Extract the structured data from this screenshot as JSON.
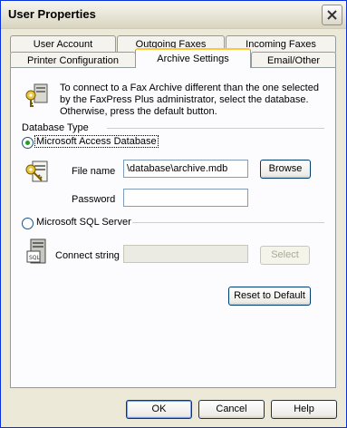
{
  "window": {
    "title": "User Properties"
  },
  "tabs_row1": [
    {
      "label": "User Account"
    },
    {
      "label": "Outgoing Faxes"
    },
    {
      "label": "Incoming Faxes"
    }
  ],
  "tabs_row2": [
    {
      "label": "Printer Configuration"
    },
    {
      "label": "Archive Settings",
      "active": true
    },
    {
      "label": "Email/Other"
    }
  ],
  "archive": {
    "intro_text": "To connect to a Fax Archive different than the one selected by the FaxPress Plus administrator, select the database. Otherwise, press the default button.",
    "db_type_label": "Database Type",
    "access_option": {
      "label": "Microsoft Access Database",
      "selected": true
    },
    "file_name": {
      "label": "File name",
      "value": "\\database\\archive.mdb"
    },
    "browse_label": "Browse",
    "password": {
      "label": "Password",
      "value": ""
    },
    "sql_option": {
      "label": "Microsoft SQL Server",
      "selected": false
    },
    "connect_string": {
      "label": "Connect string",
      "value": ""
    },
    "select_label": "Select",
    "reset_label": "Reset to Default"
  },
  "footer": {
    "ok": "OK",
    "cancel": "Cancel",
    "help": "Help"
  }
}
